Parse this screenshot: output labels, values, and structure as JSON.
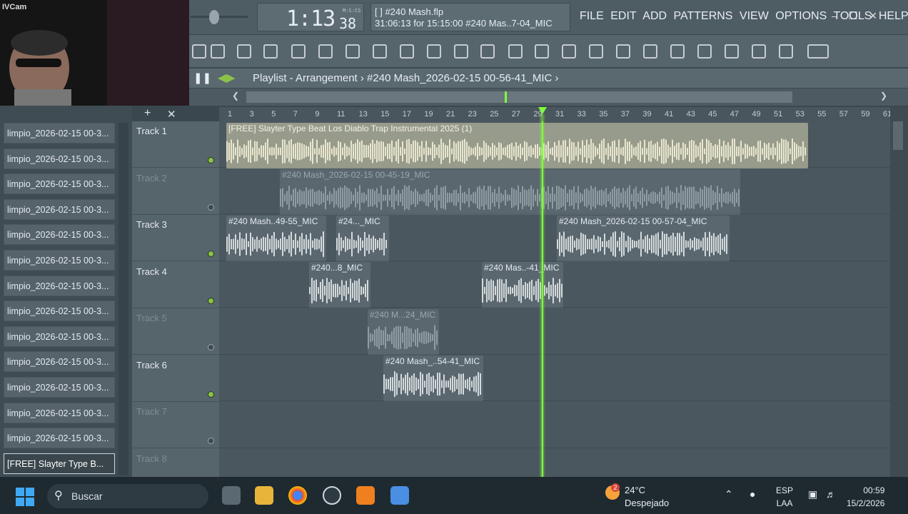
{
  "webcam": {
    "label": "IVCam"
  },
  "transport": {
    "time": "1:13",
    "seconds": "38",
    "mcs_label": "M:S:CS"
  },
  "hint": {
    "line1": "[    ] #240 Mash.flp",
    "line2": "31:06:13 for 15:15:00 #240 Mas..7-04_MIC"
  },
  "menu": [
    "FILE",
    "EDIT",
    "ADD",
    "PATTERNS",
    "VIEW",
    "OPTIONS",
    "TOOLS",
    "HELP"
  ],
  "playlist": {
    "title": "Playlist - Arrangement  ›  #240 Mash_2026-02-15 00-56-41_MIC  ›"
  },
  "browser_items": [
    "limpio_2026-02-15 00-3...",
    "limpio_2026-02-15 00-3...",
    "limpio_2026-02-15 00-3...",
    "limpio_2026-02-15 00-3...",
    "limpio_2026-02-15 00-3...",
    "limpio_2026-02-15 00-3...",
    "limpio_2026-02-15 00-3...",
    "limpio_2026-02-15 00-3...",
    "limpio_2026-02-15 00-3...",
    "limpio_2026-02-15 00-3...",
    "limpio_2026-02-15 00-3...",
    "limpio_2026-02-15 00-3...",
    "limpio_2026-02-15 00-3...",
    "[FREE] Slayter Type B..."
  ],
  "tracks": [
    "Track 1",
    "Track 2",
    "Track 3",
    "Track 4",
    "Track 5",
    "Track 6",
    "Track 7",
    "Track 8"
  ],
  "timeline_ticks": [
    "1",
    "3",
    "5",
    "7",
    "9",
    "11",
    "13",
    "15",
    "17",
    "19",
    "21",
    "23",
    "25",
    "27",
    "29",
    "31",
    "33",
    "35",
    "37",
    "39",
    "41",
    "43",
    "45",
    "47",
    "49",
    "51",
    "53",
    "55",
    "57",
    "59",
    "61"
  ],
  "clips": {
    "c1": "[FREE] Slayter Type Beat Los Diablo  Trap Instrumental 2025 (1)",
    "c2": "#240 Mash_2026-02-15 00-45-19_MIC",
    "c3a": "#240 Mash..49-55_MIC",
    "c3b": "#24..._MIC",
    "c3c": "#240 Mash_2026-02-15 00-57-04_MIC",
    "c4a": "#240...8_MIC",
    "c4b": "#240 Mas..-41_MIC",
    "c5": "#240 M...24_MIC",
    "c6": "#240 Mash_..54-41_MIC"
  },
  "taskbar": {
    "search_placeholder": "Buscar",
    "temp": "24°C",
    "weather": "Despejado",
    "weather_badge": "2",
    "lang1": "ESP",
    "lang2": "LAA",
    "time": "00:59",
    "date": "15/2/2026"
  },
  "colors": {
    "playhead": "#7dff3c",
    "clip_main": "#d7d3b0",
    "active_dot": "#8bc34a"
  }
}
